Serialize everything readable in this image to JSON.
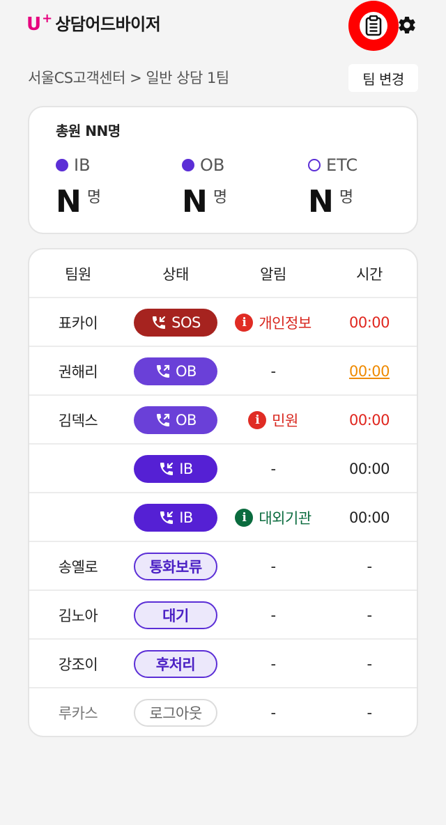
{
  "header": {
    "brand_u": "U",
    "brand_plus": "+",
    "brand_name": "상담어드바이저",
    "memo_icon": "clipboard-memo-icon",
    "settings_icon": "gear-icon"
  },
  "breadcrumb": "서울CS고객센터 > 일반 상담 1팀",
  "team_change_label": "팀 변경",
  "summary": {
    "title": "총원 NN명",
    "stats": [
      {
        "label": "IB",
        "value": "N",
        "unit": "명",
        "dot": "filled"
      },
      {
        "label": "OB",
        "value": "N",
        "unit": "명",
        "dot": "filled"
      },
      {
        "label": "ETC",
        "value": "N",
        "unit": "명",
        "dot": "hollow"
      }
    ]
  },
  "table": {
    "headers": [
      "팀원",
      "상태",
      "알림",
      "시간"
    ],
    "rows": [
      {
        "name": "표카이",
        "status": "SOS",
        "alert": "개인정보",
        "time": "00:00"
      },
      {
        "name": "권해리",
        "status": "OB",
        "alert": "-",
        "time": "00:00"
      },
      {
        "name": "김덱스",
        "status": "OB",
        "alert": "민원",
        "time": "00:00"
      },
      {
        "name": "",
        "status": "IB",
        "alert": "-",
        "time": "00:00"
      },
      {
        "name": "",
        "status": "IB",
        "alert": "대외기관",
        "time": "00:00"
      },
      {
        "name": "송옐로",
        "status": "통화보류",
        "alert": "-",
        "time": "-"
      },
      {
        "name": "김노아",
        "status": "대기",
        "alert": "-",
        "time": "-"
      },
      {
        "name": "강조이",
        "status": "후처리",
        "alert": "-",
        "time": "-"
      },
      {
        "name": "루카스",
        "status": "로그아웃",
        "alert": "-",
        "time": "-"
      }
    ]
  },
  "colors": {
    "brand": "#e6007e",
    "accent": "#5b2ed6",
    "sos": "#a6231f",
    "alert_red": "#e02c24",
    "alert_green": "#0a6b3e",
    "time_orange": "#ef8a00",
    "highlight": "#ff0000"
  }
}
